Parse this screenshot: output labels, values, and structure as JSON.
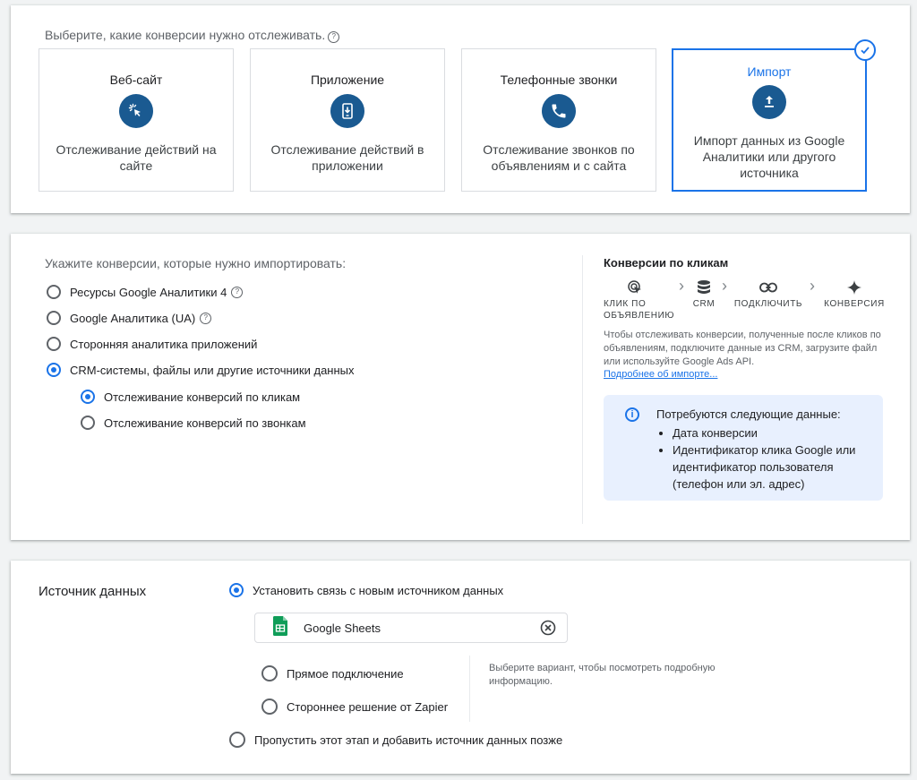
{
  "tracking": {
    "prompt": "Выберите, какие конверсии нужно отслеживать.",
    "tiles": [
      {
        "title": "Веб-сайт",
        "icon": "cursor-click-icon",
        "description": "Отслеживание действий на сайте",
        "selected": false
      },
      {
        "title": "Приложение",
        "icon": "phone-download-icon",
        "description": "Отслеживание действий в приложении",
        "selected": false
      },
      {
        "title": "Телефонные звонки",
        "icon": "phone-call-icon",
        "description": "Отслеживание звонков по объявлениям и с сайта",
        "selected": false
      },
      {
        "title": "Импорт",
        "icon": "upload-icon",
        "description": "Импорт данных из Google Аналитики или другого источника",
        "selected": true
      }
    ]
  },
  "import_section": {
    "prompt": "Укажите конверсии, которые нужно импортировать:",
    "options": [
      {
        "label": "Ресурсы Google Аналитики 4",
        "checked": false,
        "help": true
      },
      {
        "label": "Google Аналитика (UA)",
        "checked": false,
        "help": true
      },
      {
        "label": "Сторонняя аналитика приложений",
        "checked": false,
        "help": false
      },
      {
        "label": "CRM-системы, файлы или другие источники данных",
        "checked": true,
        "help": false
      }
    ],
    "sub_options": [
      {
        "label": "Отслеживание конверсий по кликам",
        "checked": true
      },
      {
        "label": "Отслеживание конверсий по звонкам",
        "checked": false
      }
    ]
  },
  "flow": {
    "title": "Конверсии по кликам",
    "steps": [
      {
        "label": "КЛИК ПО ОБЪЯВЛЕНИЮ",
        "icon": "ad-click-icon"
      },
      {
        "label": "CRM",
        "icon": "database-icon"
      },
      {
        "label": "ПОДКЛЮЧИТЬ",
        "icon": "link-icon"
      },
      {
        "label": "КОНВЕРСИЯ",
        "icon": "sparkle-icon"
      }
    ],
    "chevron": "›",
    "description": "Чтобы отслеживать конверсии, полученные после кликов по объявлениям, подключите данные из CRM, загрузите файл или используйте Google Ads API.",
    "link": "Подробнее об импорте...",
    "info": {
      "icon_glyph": "i",
      "title": "Потребуются следующие данные:",
      "items": [
        "Дата конверсии",
        "Идентификатор клика Google или идентификатор пользователя (телефон или эл. адрес)"
      ]
    }
  },
  "data_source": {
    "label": "Источник данных",
    "new_source_option": "Установить связь с новым источником данных",
    "selected_source": "Google Sheets",
    "connection_options": [
      {
        "label": "Прямое подключение",
        "checked": false
      },
      {
        "label": "Стороннее решение от Zapier",
        "checked": false
      }
    ],
    "hint": "Выберите вариант, чтобы посмотреть подробную информацию.",
    "skip_option": "Пропустить этот этап и добавить источник данных позже"
  },
  "colors": {
    "accent": "#1a73e8",
    "icon_bg": "#1a5a91",
    "info_bg": "#e8f0fe",
    "sheets_green": "#0f9d58"
  }
}
